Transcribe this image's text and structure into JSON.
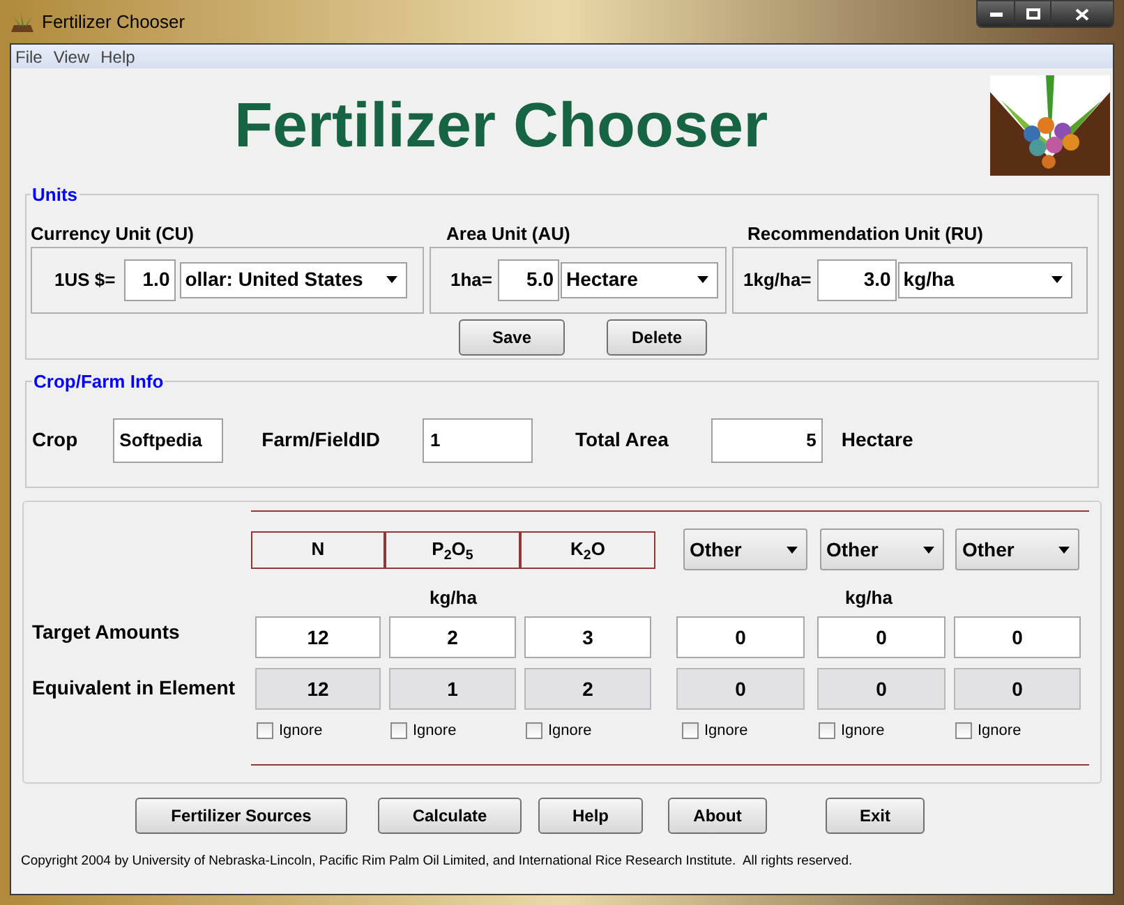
{
  "window": {
    "title": "Fertilizer Chooser"
  },
  "menu": [
    {
      "label": "File"
    },
    {
      "label": "View"
    },
    {
      "label": "Help"
    }
  ],
  "header": {
    "title": "Fertilizer Chooser"
  },
  "units": {
    "legend": "Units",
    "groups": [
      {
        "label": "Currency Unit (CU)",
        "prefix": "1US $=",
        "value": "1.0",
        "unit": "ollar: United States"
      },
      {
        "label": "Area Unit (AU)",
        "prefix": "1ha=",
        "value": "5.0",
        "unit": "Hectare"
      },
      {
        "label": "Recommendation Unit (RU)",
        "prefix": "1kg/ha=",
        "value": "3.0",
        "unit": "kg/ha"
      }
    ],
    "buttons": [
      "Save",
      "Delete"
    ]
  },
  "crop_farm": {
    "legend": "Crop/Farm Info",
    "fields": [
      {
        "label": "Crop",
        "value": "Softpedia"
      },
      {
        "label": "Farm/FieldID",
        "value": "1"
      },
      {
        "label": "Total Area",
        "value": "5"
      }
    ],
    "area_unit": "Hectare"
  },
  "nutrients": {
    "row_labels": [
      "Target Amounts",
      "Equivalent in Element"
    ],
    "unit_labels": [
      "kg/ha",
      "kg/ha"
    ],
    "columns": [
      {
        "kind": "fixed",
        "header": "N",
        "target": "12",
        "equivalent": "12",
        "ignore": {
          "label": "Ignore",
          "checked": false
        }
      },
      {
        "kind": "fixed",
        "header": "P$_{2}$O$_{5}$",
        "target": "2",
        "equivalent": "1",
        "ignore": {
          "label": "Ignore",
          "checked": false
        }
      },
      {
        "kind": "fixed",
        "header": "K$_{2}$O",
        "target": "3",
        "equivalent": "2",
        "ignore": {
          "label": "Ignore",
          "checked": false
        }
      },
      {
        "kind": "select",
        "header": "Other",
        "target": "0",
        "equivalent": "0",
        "ignore": {
          "label": "Ignore",
          "checked": false
        }
      },
      {
        "kind": "select",
        "header": "Other",
        "target": "0",
        "equivalent": "0",
        "ignore": {
          "label": "Ignore",
          "checked": false
        }
      },
      {
        "kind": "select",
        "header": "Other",
        "target": "0",
        "equivalent": "0",
        "ignore": {
          "label": "Ignore",
          "checked": false
        }
      }
    ]
  },
  "actions": [
    "Fertilizer Sources",
    "Calculate",
    "Help",
    "About",
    "Exit"
  ],
  "copyright": "Copyright 2004 by University of Nebraska-Lincoln, Pacific Rim Palm Oil Limited, and International Rice Research Institute.  All rights reserved."
}
